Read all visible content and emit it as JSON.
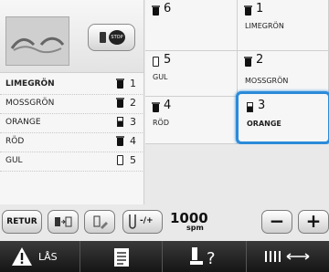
{
  "threads_list": [
    {
      "name": "LIMEGRÖN",
      "num": "1",
      "spool": "filled",
      "selected": true
    },
    {
      "name": "MOSSGRÖN",
      "num": "2",
      "spool": "filled",
      "selected": false
    },
    {
      "name": "ORANGE",
      "num": "3",
      "spool": "half",
      "selected": false
    },
    {
      "name": "RÖD",
      "num": "4",
      "spool": "filled",
      "selected": false
    },
    {
      "name": "GUL",
      "num": "5",
      "spool": "empty",
      "selected": false
    }
  ],
  "needles": [
    {
      "num": "6",
      "name": "",
      "spool": "filled"
    },
    {
      "num": "1",
      "name": "LIMEGRÖN",
      "spool": "filled"
    },
    {
      "num": "5",
      "name": "GUL",
      "spool": "empty"
    },
    {
      "num": "2",
      "name": "MOSSGRÖN",
      "spool": "filled"
    },
    {
      "num": "4",
      "name": "RÖD",
      "spool": "filled"
    },
    {
      "num": "3",
      "name": "ORANGE",
      "spool": "half",
      "selected": true
    }
  ],
  "toolbar": {
    "retur_label": "RETUR",
    "tension_label": "-/+",
    "spm_value": "1000",
    "spm_unit": "spm",
    "minus_label": "−",
    "plus_label": "+"
  },
  "bottom_bar": {
    "lock_label": "LÅS"
  },
  "colors": {
    "accent": "#2b8bd9",
    "bottom_bar": "#1c1c1c"
  },
  "icons": [
    "embroidery-thumbnail",
    "stop-icon",
    "spool-icon",
    "swap-needles-icon",
    "clear-icon",
    "tension-icon",
    "warning-icon",
    "document-icon",
    "needle-help-icon",
    "thread-width-icon"
  ]
}
